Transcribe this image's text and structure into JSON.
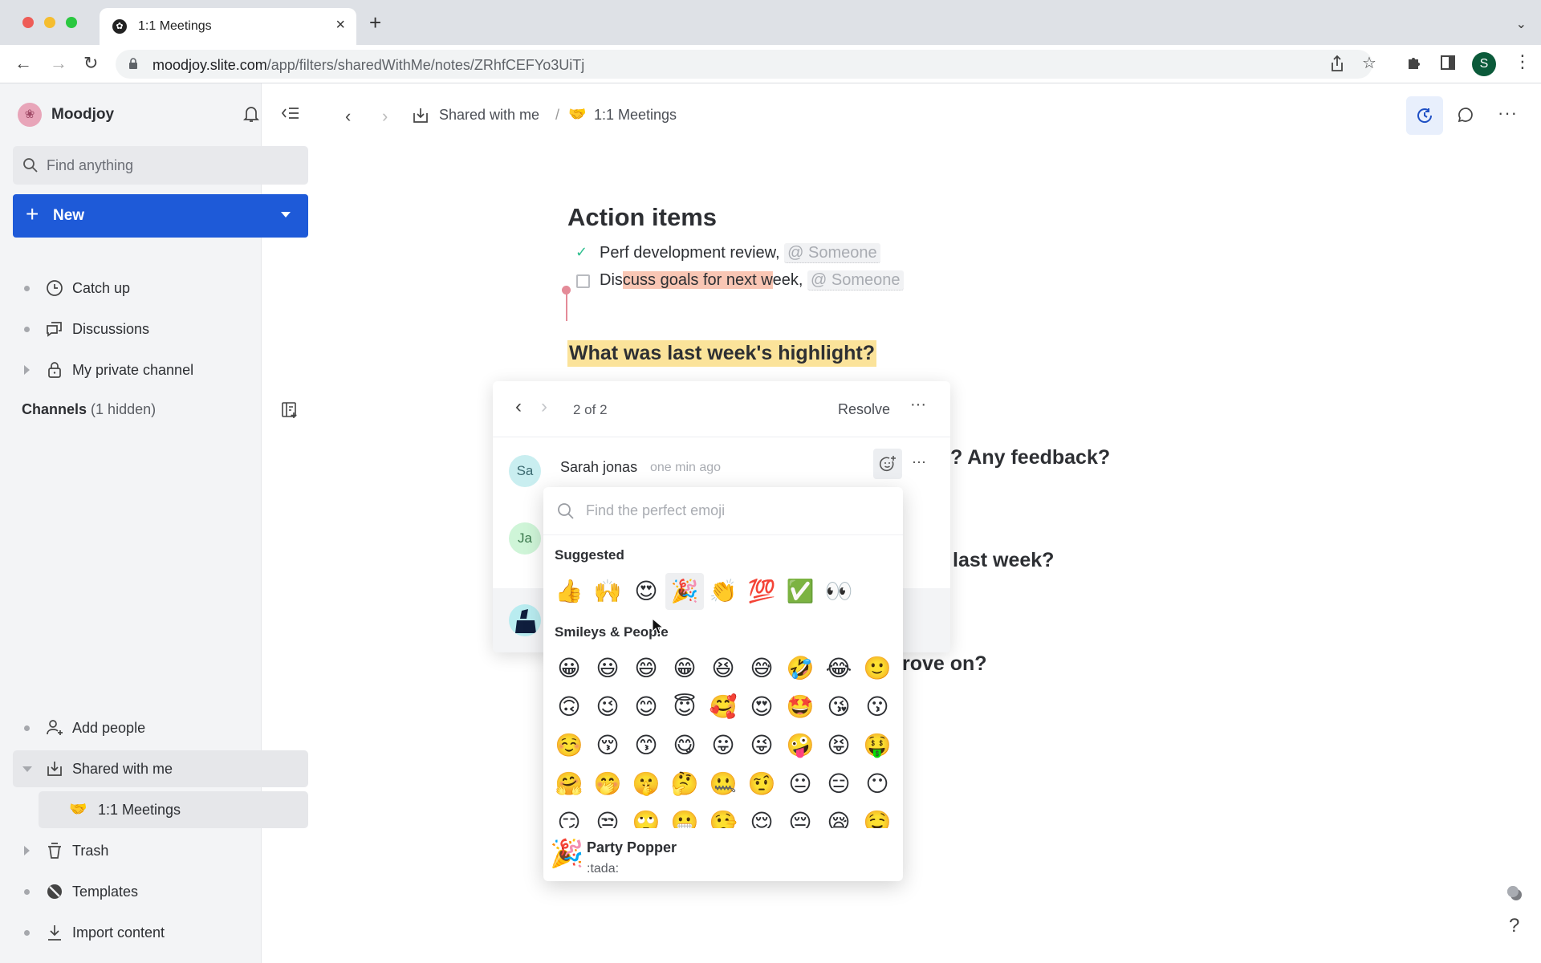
{
  "browser": {
    "tab_title": "1:1 Meetings",
    "url_host": "moodjoy.slite.com",
    "url_path": "/app/filters/sharedWithMe/notes/ZRhfCEFYo3UiTj",
    "profile_initial": "S"
  },
  "sidebar": {
    "workspace_name": "Moodjoy",
    "search_placeholder": "Find anything",
    "new_button_label": "New",
    "top_items": [
      {
        "label": "Catch up",
        "icon": "clock-icon"
      },
      {
        "label": "Discussions",
        "icon": "chat-icon"
      },
      {
        "label": "My private channel",
        "icon": "lock-icon"
      }
    ],
    "channels_label": "Channels",
    "channels_hidden": "(1 hidden)",
    "bottom_items": [
      {
        "label": "Add people",
        "icon": "add-person-icon"
      },
      {
        "label": "Shared with me",
        "icon": "inbox-download-icon"
      },
      {
        "label": "1:1 Meetings",
        "icon": "handshake-emoji",
        "emoji": "🤝"
      },
      {
        "label": "Trash",
        "icon": "trash-icon"
      },
      {
        "label": "Templates",
        "icon": "templates-icon"
      },
      {
        "label": "Import content",
        "icon": "import-icon"
      }
    ]
  },
  "breadcrumb": {
    "parent": "Shared with me",
    "separator": "/",
    "current_emoji": "🤝",
    "current": "1:1 Meetings"
  },
  "document": {
    "heading_action_items": "Action items",
    "todos": [
      {
        "checked": true,
        "text": "Perf development review,",
        "mention": "@ Someone"
      },
      {
        "checked": false,
        "text_before": "Dis",
        "text_highlight": "cuss goals for next w",
        "text_after": "eek,",
        "mention": "@ Someone"
      }
    ],
    "heading_highlight": "What was last week's highlight?",
    "bg_heading_1_visible": "? Any feedback?",
    "bg_heading_2_visible": "last week?",
    "bg_heading_3_visible": "rove on?"
  },
  "comment_thread": {
    "position": "2 of 2",
    "resolve_label": "Resolve",
    "comments": [
      {
        "initials": "Sa",
        "author": "Sarah jonas",
        "time": "one min ago"
      },
      {
        "initials": "Ja"
      }
    ]
  },
  "emoji_picker": {
    "search_placeholder": "Find the perfect emoji",
    "suggested_label": "Suggested",
    "suggested": [
      "👍",
      "🙌",
      "😍",
      "🎉",
      "👏",
      "💯",
      "✅",
      "👀"
    ],
    "smileys_label": "Smileys & People",
    "smileys_rows": [
      [
        "😀",
        "😃",
        "😄",
        "😁",
        "😆",
        "😅",
        "🤣",
        "😂",
        "🙂"
      ],
      [
        "🙃",
        "😉",
        "😊",
        "😇",
        "🥰",
        "😍",
        "🤩",
        "😘",
        "😗"
      ],
      [
        "☺️",
        "😚",
        "😙",
        "😋",
        "😛",
        "😜",
        "🤪",
        "😝",
        "🤑"
      ],
      [
        "🤗",
        "🤭",
        "🤫",
        "🤔",
        "🤐",
        "🤨",
        "😐",
        "😑",
        "😶"
      ],
      [
        "😏",
        "😒",
        "🙄",
        "😬",
        "🤥",
        "😌",
        "😔",
        "😪",
        "🤤"
      ]
    ],
    "preview": {
      "emoji": "🎉",
      "name": "Party Popper",
      "shortcode": ":tada:"
    }
  },
  "colors": {
    "accent": "#1e5ad8",
    "highlight_yellow": "#fbe39a",
    "highlight_salmon": "#f9c6b4",
    "check_green": "#2fbf8f"
  }
}
